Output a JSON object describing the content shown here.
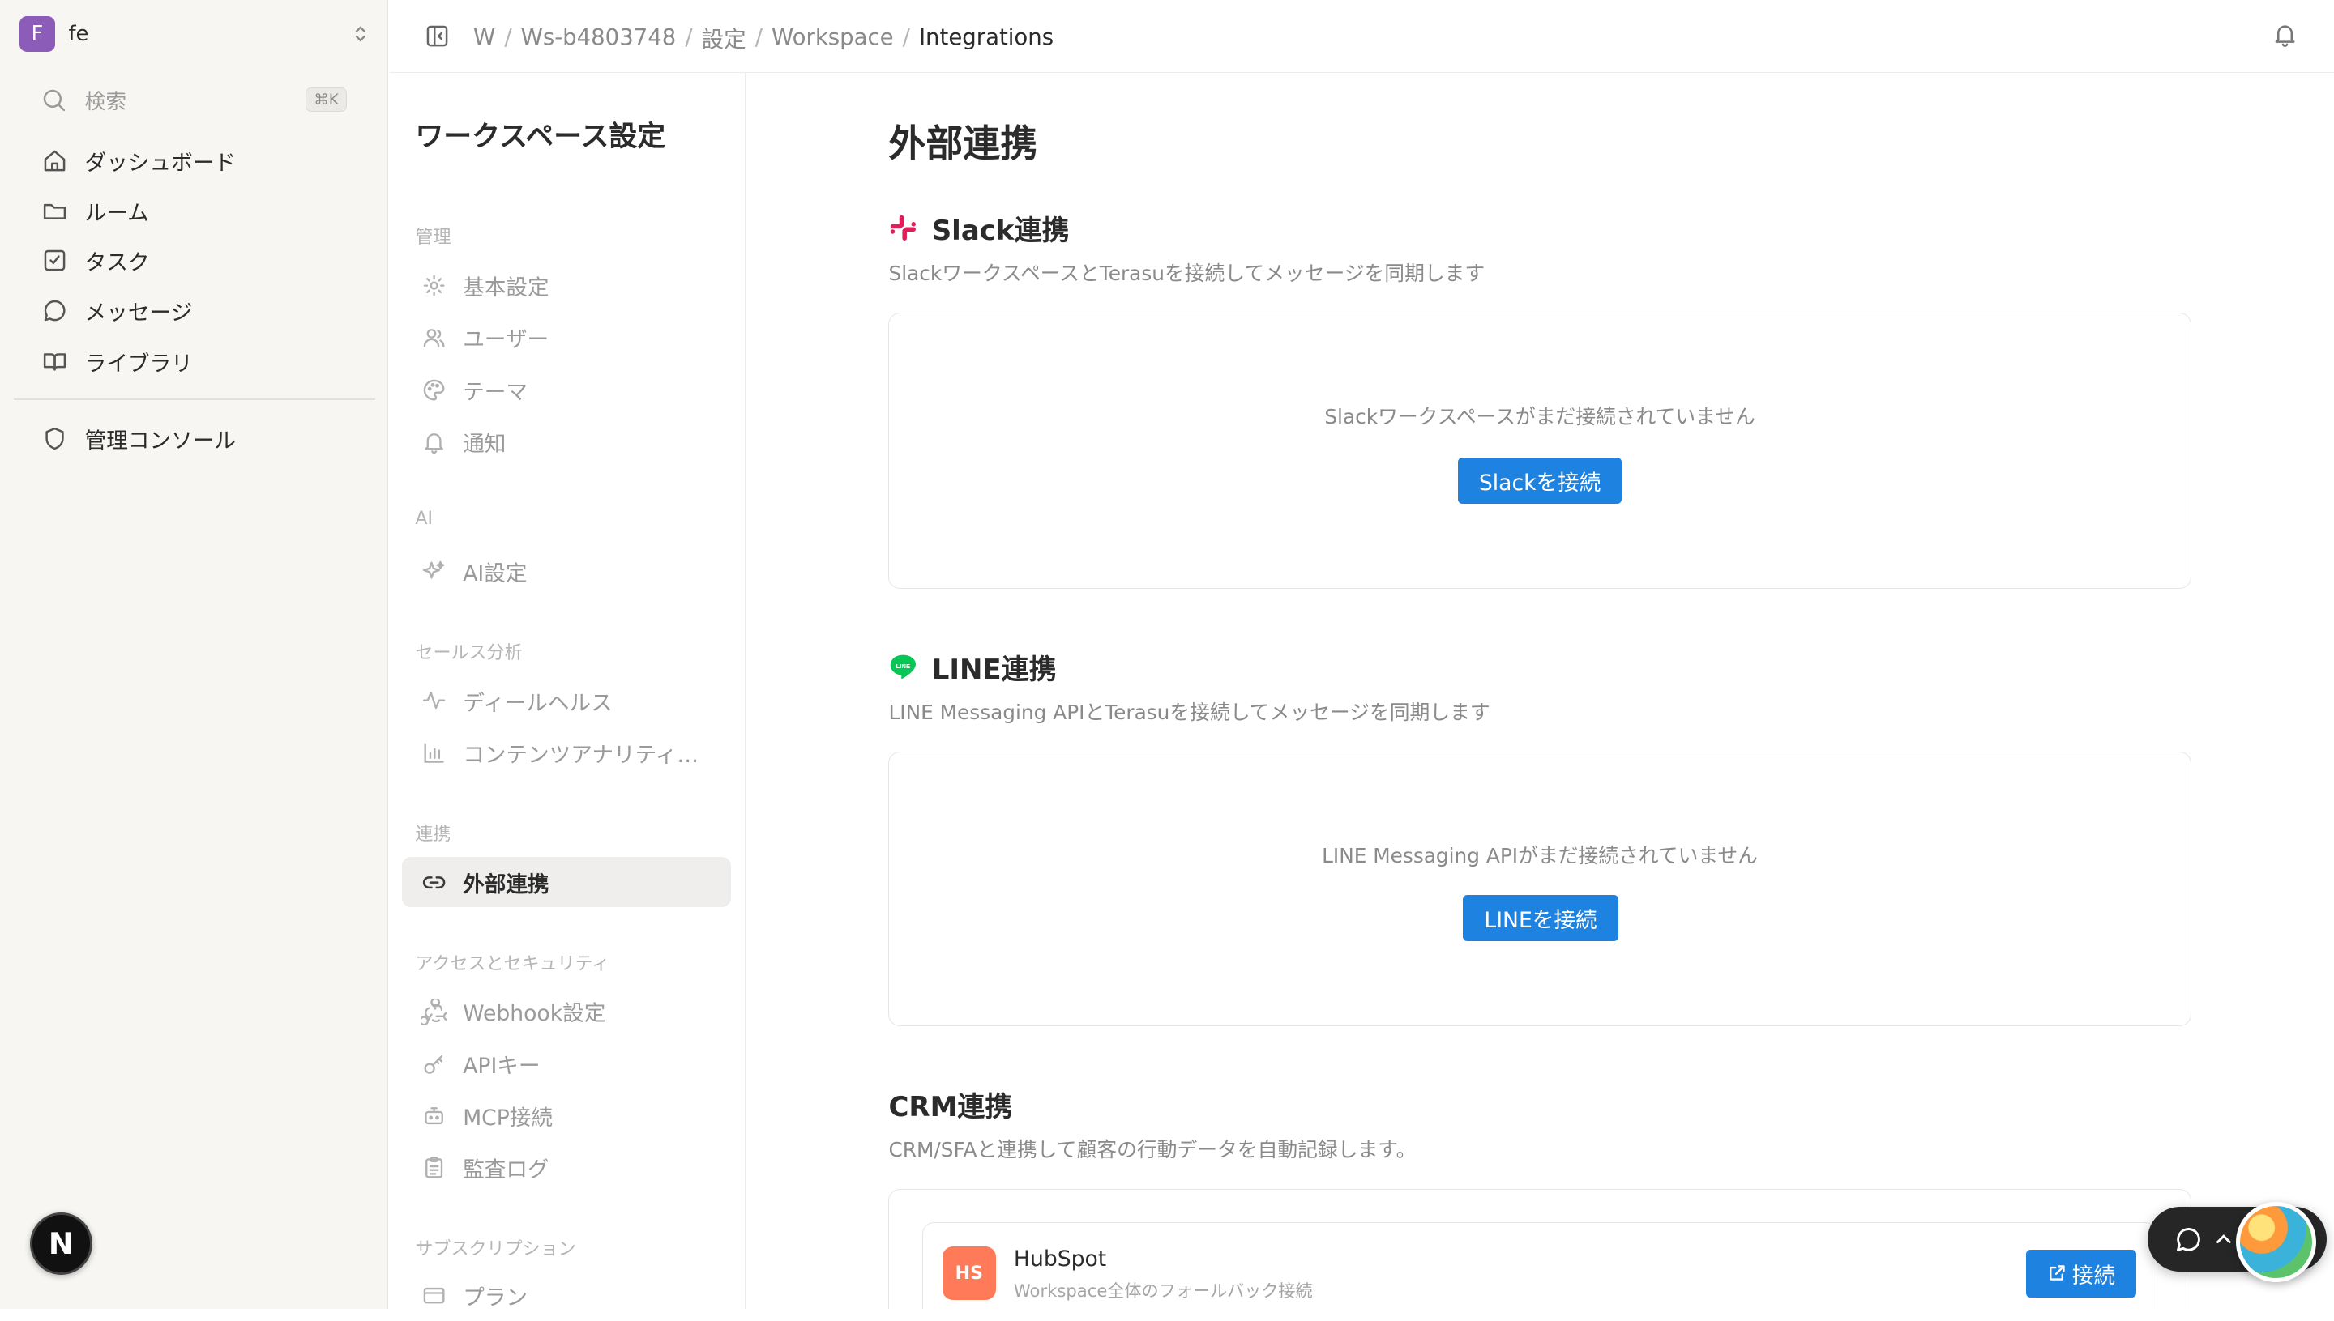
{
  "workspace": {
    "initial": "F",
    "name": "fe"
  },
  "search": {
    "label": "検索",
    "shortcut": "⌘K"
  },
  "sidebar": {
    "items": [
      {
        "label": "ダッシュボード",
        "icon": "home-icon"
      },
      {
        "label": "ルーム",
        "icon": "folder-icon"
      },
      {
        "label": "タスク",
        "icon": "checkbox-icon"
      },
      {
        "label": "メッセージ",
        "icon": "message-icon"
      },
      {
        "label": "ライブラリ",
        "icon": "book-icon"
      }
    ],
    "admin": {
      "label": "管理コンソール",
      "icon": "shield-icon"
    }
  },
  "next_badge": "N",
  "breadcrumb": [
    "W",
    "Ws-b4803748",
    "設定",
    "Workspace",
    "Integrations"
  ],
  "settings_nav": {
    "title": "ワークスペース設定",
    "sections": [
      {
        "label": "管理",
        "items": [
          {
            "label": "基本設定",
            "icon": "gear-icon"
          },
          {
            "label": "ユーザー",
            "icon": "users-icon"
          },
          {
            "label": "テーマ",
            "icon": "palette-icon"
          },
          {
            "label": "通知",
            "icon": "bell-icon"
          }
        ]
      },
      {
        "label": "AI",
        "items": [
          {
            "label": "AI設定",
            "icon": "sparkles-icon"
          }
        ]
      },
      {
        "label": "セールス分析",
        "items": [
          {
            "label": "ディールヘルス",
            "icon": "activity-icon"
          },
          {
            "label": "コンテンツアナリティクス",
            "icon": "bar-chart-icon"
          }
        ]
      },
      {
        "label": "連携",
        "items": [
          {
            "label": "外部連携",
            "icon": "link-icon",
            "active": true
          }
        ]
      },
      {
        "label": "アクセスとセキュリティ",
        "items": [
          {
            "label": "Webhook設定",
            "icon": "webhook-icon"
          },
          {
            "label": "APIキー",
            "icon": "key-icon"
          },
          {
            "label": "MCP接続",
            "icon": "bot-icon"
          },
          {
            "label": "監査ログ",
            "icon": "clipboard-icon"
          }
        ]
      },
      {
        "label": "サブスクリプション",
        "items": [
          {
            "label": "プラン",
            "icon": "card-icon"
          }
        ]
      }
    ]
  },
  "main": {
    "title": "外部連携",
    "slack": {
      "title": "Slack連携",
      "description": "SlackワークスペースとTerasuを接続してメッセージを同期します",
      "empty": "Slackワークスペースがまだ接続されていません",
      "button": "Slackを接続"
    },
    "line": {
      "title": "LINE連携",
      "description": "LINE Messaging APIとTerasuを接続してメッセージを同期します",
      "empty": "LINE Messaging APIがまだ接続されていません",
      "button": "LINEを接続",
      "logo_text": "LINE"
    },
    "crm": {
      "title": "CRM連携",
      "description": "CRM/SFAと連携して顧客の行動データを自動記録します。",
      "hubspot": {
        "logo": "HS",
        "name": "HubSpot",
        "description": "Workspace全体のフォールバック接続",
        "button": "接続"
      }
    }
  },
  "colors": {
    "accent": "#1e82e0",
    "workspace_avatar": "#8b5cb8",
    "hubspot": "#ff7a59",
    "line_green": "#06c755"
  }
}
